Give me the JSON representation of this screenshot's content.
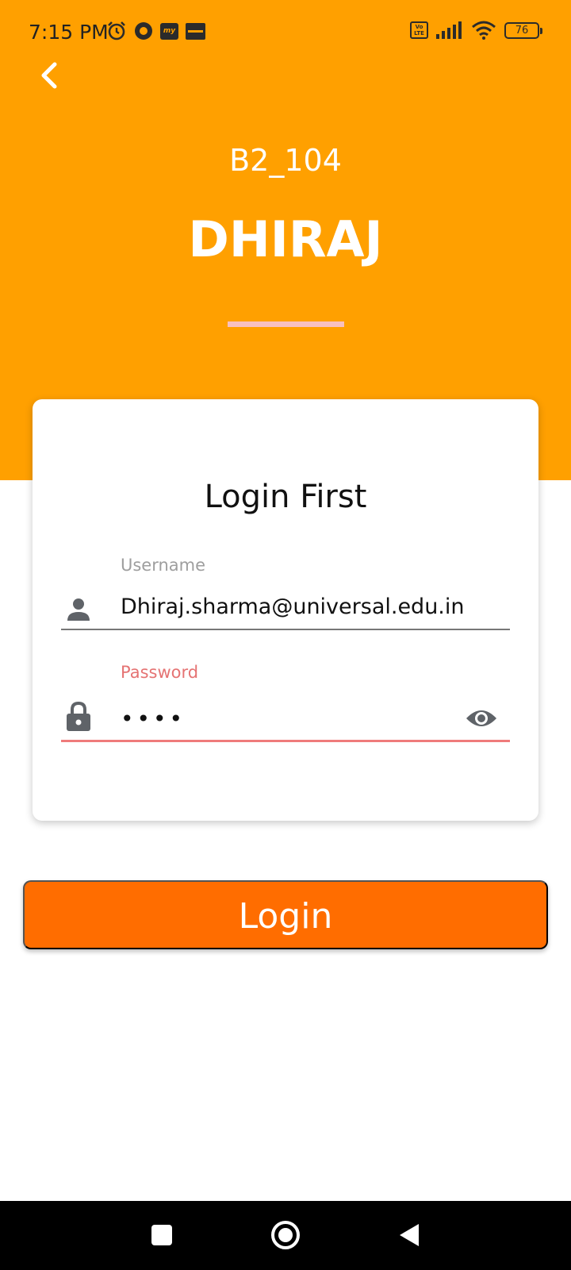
{
  "status_bar": {
    "time": "7:15 PM",
    "volte_label_top": "Vo",
    "volte_label_bottom": "LTE",
    "battery_level": "76",
    "app_badges": [
      "my",
      "zomato"
    ]
  },
  "header": {
    "room_code": "B2_104",
    "user_name": "DHIRAJ",
    "background_color": "#ffa000",
    "divider_color": "#f8c0c0"
  },
  "login_card": {
    "title": "Login First",
    "username": {
      "label": "Username",
      "value": "Dhiraj.sharma@universal.edu.in",
      "icon": "person-icon"
    },
    "password": {
      "label": "Password",
      "value": "••••",
      "icon": "lock-icon",
      "toggle_icon": "eye-icon",
      "accent_color": "#e57373"
    }
  },
  "login_button": {
    "label": "Login",
    "color": "#ff6d00"
  },
  "nav_bar": {
    "buttons": [
      "recents-square-icon",
      "home-circle-icon",
      "back-triangle-icon"
    ]
  }
}
